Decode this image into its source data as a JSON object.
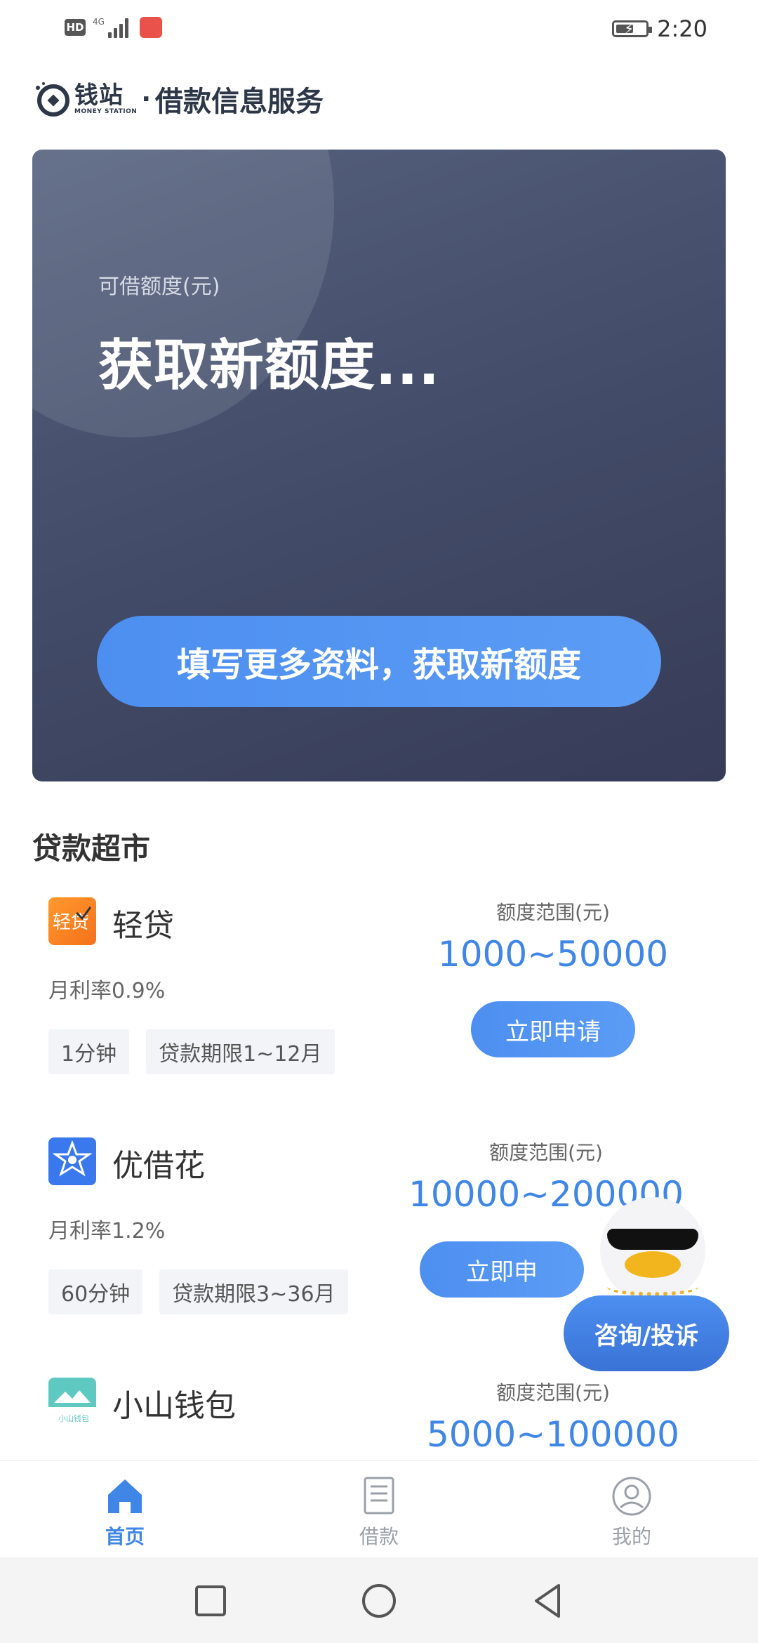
{
  "status_bar": {
    "hd": "HD",
    "network": "4G",
    "time": "2:20",
    "battery_level": 0.6
  },
  "header": {
    "logo_name": "钱站",
    "logo_sub": "MONEY STATION",
    "separator": "·",
    "service": "借款信息服务"
  },
  "card": {
    "label": "可借额度(元)",
    "value": "获取新额度...",
    "cta": "填写更多资料，获取新额度"
  },
  "section": {
    "title": "贷款超市"
  },
  "products": [
    {
      "name": "轻贷",
      "icon": "qingdai-logo",
      "rate": "月利率0.9%",
      "tags": [
        "1分钟",
        "贷款期限1~12月"
      ],
      "range_label": "额度范围(元)",
      "range": "1000~50000",
      "apply": "立即申请"
    },
    {
      "name": "优借花",
      "icon": "youjiehua-logo",
      "rate": "月利率1.2%",
      "tags": [
        "60分钟",
        "贷款期限3~36月"
      ],
      "range_label": "额度范围(元)",
      "range": "10000~200000",
      "apply": "立即申"
    },
    {
      "name": "小山钱包",
      "icon": "xiaoshan-logo",
      "range_label": "额度范围(元)",
      "range": "5000~100000"
    }
  ],
  "floating": {
    "consult": "咨询/投诉"
  },
  "bottom_nav": [
    {
      "label": "首页",
      "icon": "home-icon",
      "active": true
    },
    {
      "label": "借款",
      "icon": "receipt-icon",
      "active": false
    },
    {
      "label": "我的",
      "icon": "user-icon",
      "active": false
    }
  ],
  "colors": {
    "accent": "#3f86e6",
    "card_bg": "#414a66",
    "button": "#4d8ff0"
  }
}
